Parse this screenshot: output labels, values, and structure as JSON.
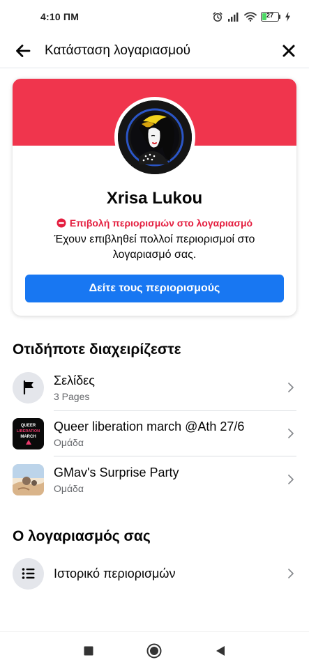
{
  "status_bar": {
    "time": "4:10 ΠΜ",
    "battery_level": "27",
    "battery_fraction": 0.27
  },
  "header": {
    "title": "Κατάσταση λογαριασμού"
  },
  "profile": {
    "name": "Xrisa Lukou",
    "restriction_label": "Επιβολή περιορισμών στο λογαριασμό",
    "restriction_description": "Έχουν επιβληθεί πολλοί περιορισμοί στο λογαριασμό σας.",
    "view_button_label": "Δείτε τους περιορισμούς"
  },
  "managed": {
    "heading": "Οτιδήποτε διαχειρίζεστε",
    "items": [
      {
        "title": "Σελίδες",
        "subtitle": "3 Pages",
        "icon": "flag-icon"
      },
      {
        "title": "Queer liberation march @Ath 27/6",
        "subtitle": "Ομάδα",
        "thumb_text_1": "QUEER",
        "thumb_text_2": "LIBERATION",
        "thumb_text_3": "MARCH"
      },
      {
        "title": "GMav's Surprise Party",
        "subtitle": "Ομάδα"
      }
    ]
  },
  "account": {
    "heading": "Ο λογαριασμός σας",
    "items": [
      {
        "title": "Ιστορικό περιορισμών",
        "icon": "list-icon"
      }
    ]
  },
  "colors": {
    "banner": "#f0354d",
    "primary_button": "#1877f2",
    "restriction_red": "#e41e3f"
  }
}
